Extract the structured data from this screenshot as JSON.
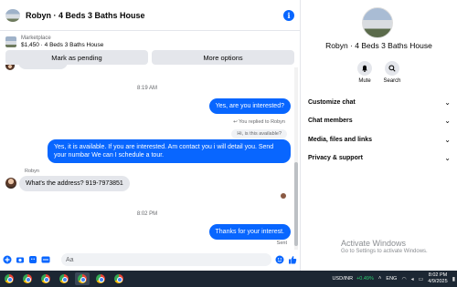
{
  "header": {
    "title": "Robyn · 4 Beds 3 Baths House",
    "info_icon": "i"
  },
  "listing": {
    "source": "Marketplace",
    "title": "$1,450 · 4 Beds 3 Baths House"
  },
  "actions": {
    "mark_pending": "Mark as pending",
    "more_options": "More options"
  },
  "messages": {
    "time1": "8:19 AM",
    "out1": "Yes, are you interested?",
    "replied_label": "You replied to Robyn",
    "quoted": "Hi, is this available?",
    "out2": "Yes, it is available. If you are interested. Am contact you i will detail you. Send your numbar We can I schedule a tour.",
    "sender": "Robyn",
    "in1": "What's the address? 919-7973851",
    "time2": "8:02 PM",
    "out3": "Thanks for your interest.",
    "sent": "Sent"
  },
  "composer": {
    "placeholder": "Aa"
  },
  "details": {
    "title": "Robyn · 4 Beds 3 Baths House",
    "mute": "Mute",
    "search": "Search",
    "sections": [
      "Customize chat",
      "Chat members",
      "Media, files and links",
      "Privacy & support"
    ]
  },
  "watermark": {
    "line1": "Activate Windows",
    "line2": "Go to Settings to activate Windows."
  },
  "taskbar": {
    "stock": "USD/INR",
    "stock_change": "+0.49%",
    "lang": "ENG",
    "time": "8:02 PM",
    "date": "4/9/2025"
  },
  "colors": {
    "accent": "#0866ff",
    "bubble_in": "#e4e6eb",
    "taskbar": "#1c2733"
  }
}
